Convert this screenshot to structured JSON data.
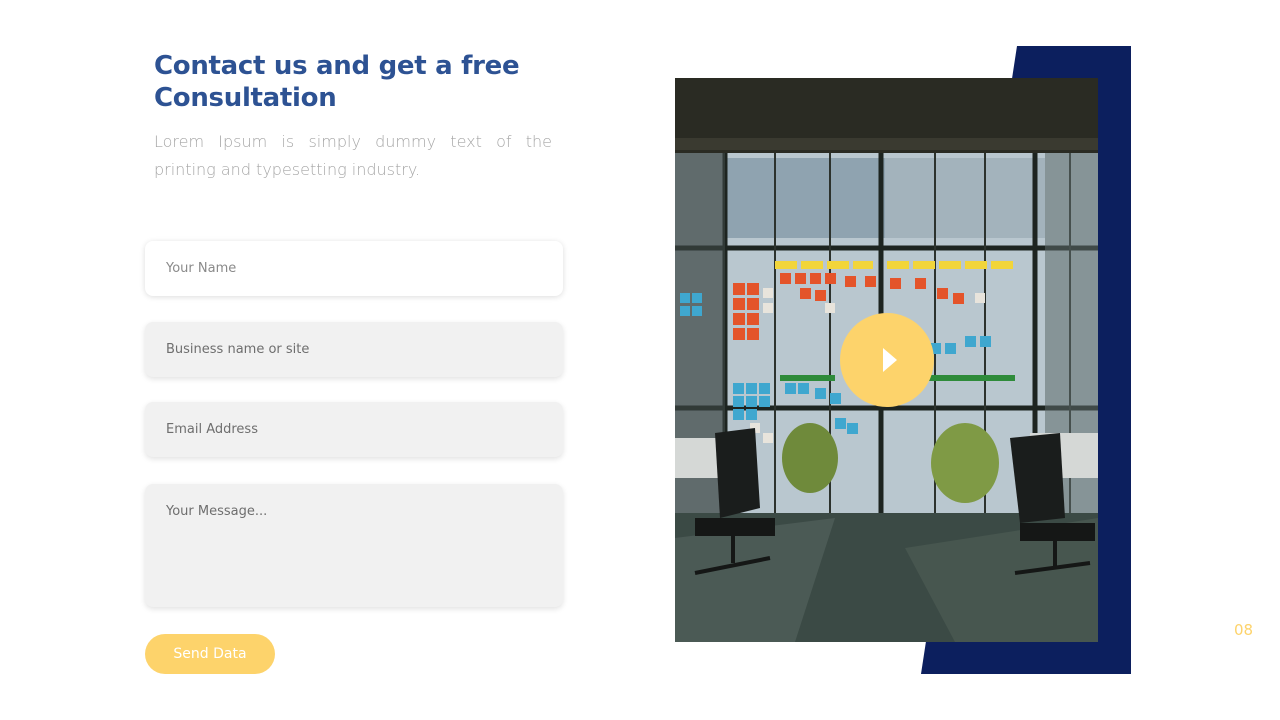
{
  "heading": {
    "title": "Contact us and get a free Consultation",
    "subtitle": "Lorem Ipsum is simply dummy text of the printing and typesetting industry."
  },
  "form": {
    "name_placeholder": "Your Name",
    "business_placeholder": "Business name or site",
    "email_placeholder": "Email Address",
    "message_placeholder": "Your Message...",
    "send_label": "Send Data"
  },
  "media": {
    "photo_description_icon": "office-photo",
    "play_icon": "play-icon"
  },
  "page_number": "08",
  "colors": {
    "title": "#2d5293",
    "accent_yellow": "#fdd36b",
    "navy": "#0c1f5e",
    "field_bg": "#f1f1f1"
  }
}
